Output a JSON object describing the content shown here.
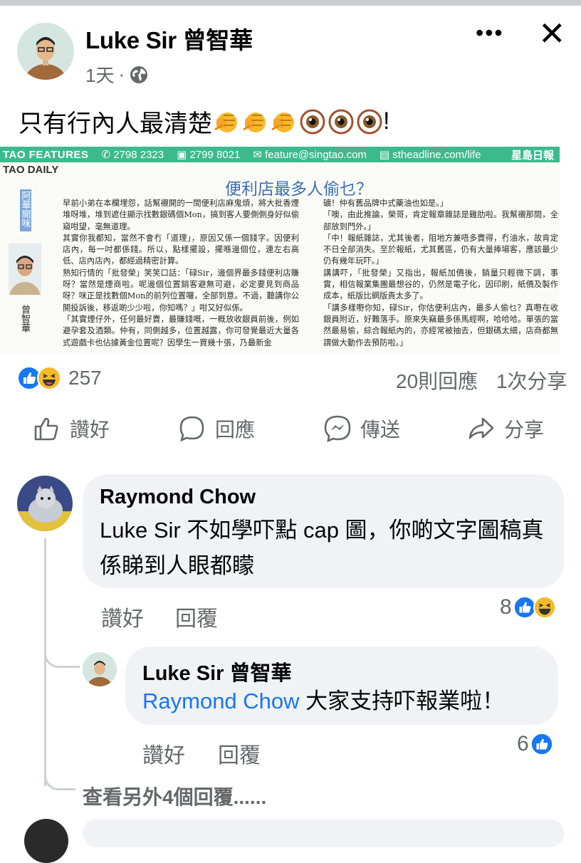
{
  "post": {
    "author": "Luke Sir 曾智華",
    "time": "1天",
    "separator": "·",
    "text": "只有行內人最清楚",
    "text_suffix": "!",
    "emoji_icons": [
      "punch-icon",
      "punch-icon",
      "punch-icon",
      "eye-icon",
      "eye-icon",
      "eye-icon"
    ]
  },
  "newspaper": {
    "brand": "TAO FEATURES",
    "phone1": "2798 2323",
    "phone2": "2799 8021",
    "email": "feature@singtao.com",
    "site": "stheadline.com/life",
    "masthead": "星島日報",
    "daily": "TAO DAILY",
    "column_name": "阿華開咪",
    "author": "曾智華",
    "headline": "便利店最多人偷乜？",
    "col1": "早前小弟在本欄埋怨，話幫襯開的一間便利店麻鬼煩，將大批香煙堆呀堆，堆到遮住顯示找數銀碼個Mon，搞到客人要側側身好似偷窺咁望，毫無道理。\n其實你我都知，當然不會冇「道理」，原因又係一個錢字。因便利店內，每一吋都係錢。所以，點樣擺設，擺喺邊個位，連左右高低、店內店內，都經過精密計算。\n熟知行情的「批發榮」笑笑口話：「碌Sir，邊個界最多錢便利店賺呀？當然是煙商啦。呢邊個位置銷客避無可避，必定要見到商品呀？咪正是找數個Mon的前列位置囉，全部到意。不過，聽講你公開投訴後，移返啲少少啦，你知嗎？」咁又好似係。\n「其實煙仔外，任何最好賣，最賺錢嘅，一概放收銀員前後，例如避孕套及酒類。仲有，同側越多，位置越露，你可發覺最近大量各式遊戲卡也佔據黃金位置呢？因學生一買幾十張，乃最新金",
    "col2": "礦！仲有舊品牌中式藥油也如是。」\n「噢，由此推論，榮哥，肯定報章雜誌是雞肋啦。我幫襯那間，全部放到門外。」\n「中！報紙雜誌，尤其後者，阻地方兼唔多賣得，冇油水，故肯定不日全部消失。至於報紙，尤其舊區，仍有大量捧場客，應該最少仍有幾年玩吓。」\n講講吓，「批發榮」又指出，報紙加價後，銷量只輕微下調，事實，相信報業集團最想谷的，仍然是電子化，因印刷，紙價及製作成本，紙版比網版貴太多了。\n「講多樣嘢你知，碌Sir，你估便利店內，最多人偷乜？真嘢在收銀員附近，好難落手。原來失竊最多係馬經啊，哈哈哈。單張的當然最易偷，綜合報紙內的，亦經常被抽去，但銀碼太細，店商都無謂做大動作去預防啦。」"
  },
  "reactions": {
    "count": "257",
    "comments": "20則回應",
    "shares": "1次分享"
  },
  "actions": {
    "like": "讚好",
    "comment": "回應",
    "send": "傳送",
    "share": "分享"
  },
  "comments": [
    {
      "name": "Raymond Chow",
      "text": "Luke Sir 不如學吓點 cap 圖，你啲文字圖稿真係睇到人眼都矇",
      "like": "讚好",
      "reply": "回覆",
      "reaction_count": "8"
    },
    {
      "name": "Luke Sir 曾智華",
      "mention": "Raymond Chow",
      "text": " 大家支持吓報業啦！",
      "like": "讚好",
      "reply": "回覆",
      "reaction_count": "6"
    }
  ],
  "more_replies": "查看另外4個回覆......",
  "colors": {
    "link": "#1877f2",
    "like_blue": "#1877f2",
    "haha_yellow": "#f7b928",
    "tao_green": "#3dba8d",
    "headline_blue": "#3c6fb7"
  }
}
